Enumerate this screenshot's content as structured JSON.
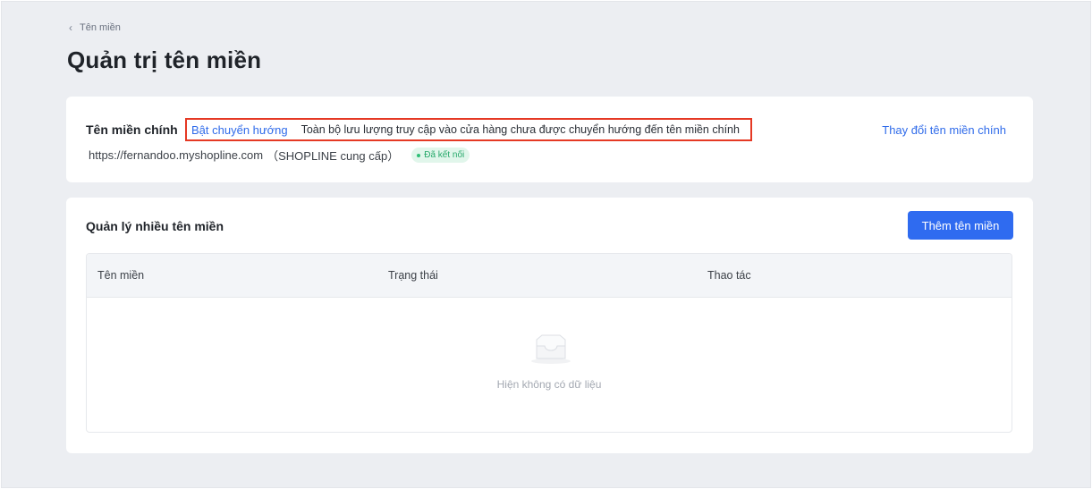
{
  "breadcrumb": {
    "back_label": "Tên miền"
  },
  "page": {
    "title": "Quản trị tên miền"
  },
  "primary_domain": {
    "label": "Tên miền chính",
    "redirect_link": "Bật chuyển hướng",
    "redirect_description": "Toàn bộ lưu lượng truy cập vào cửa hàng chưa được chuyển hướng đến tên miền chính",
    "change_link": "Thay đổi tên miền chính",
    "url": "https://fernandoo.myshopline.com",
    "provider": "（SHOPLINE cung cấp）",
    "status": "Đã kết nối",
    "status_color": "#26a86a",
    "highlight_color": "#e53924"
  },
  "multi_domain": {
    "title": "Quản lý nhiều tên miền",
    "add_button": "Thêm tên miền",
    "columns": [
      "Tên miền",
      "Trạng thái",
      "Thao tác"
    ],
    "rows": [],
    "empty_text": "Hiện không có dữ liệu",
    "empty_icon": "inbox-icon"
  },
  "colors": {
    "accent": "#2f6bf0",
    "background": "#eceef2"
  }
}
